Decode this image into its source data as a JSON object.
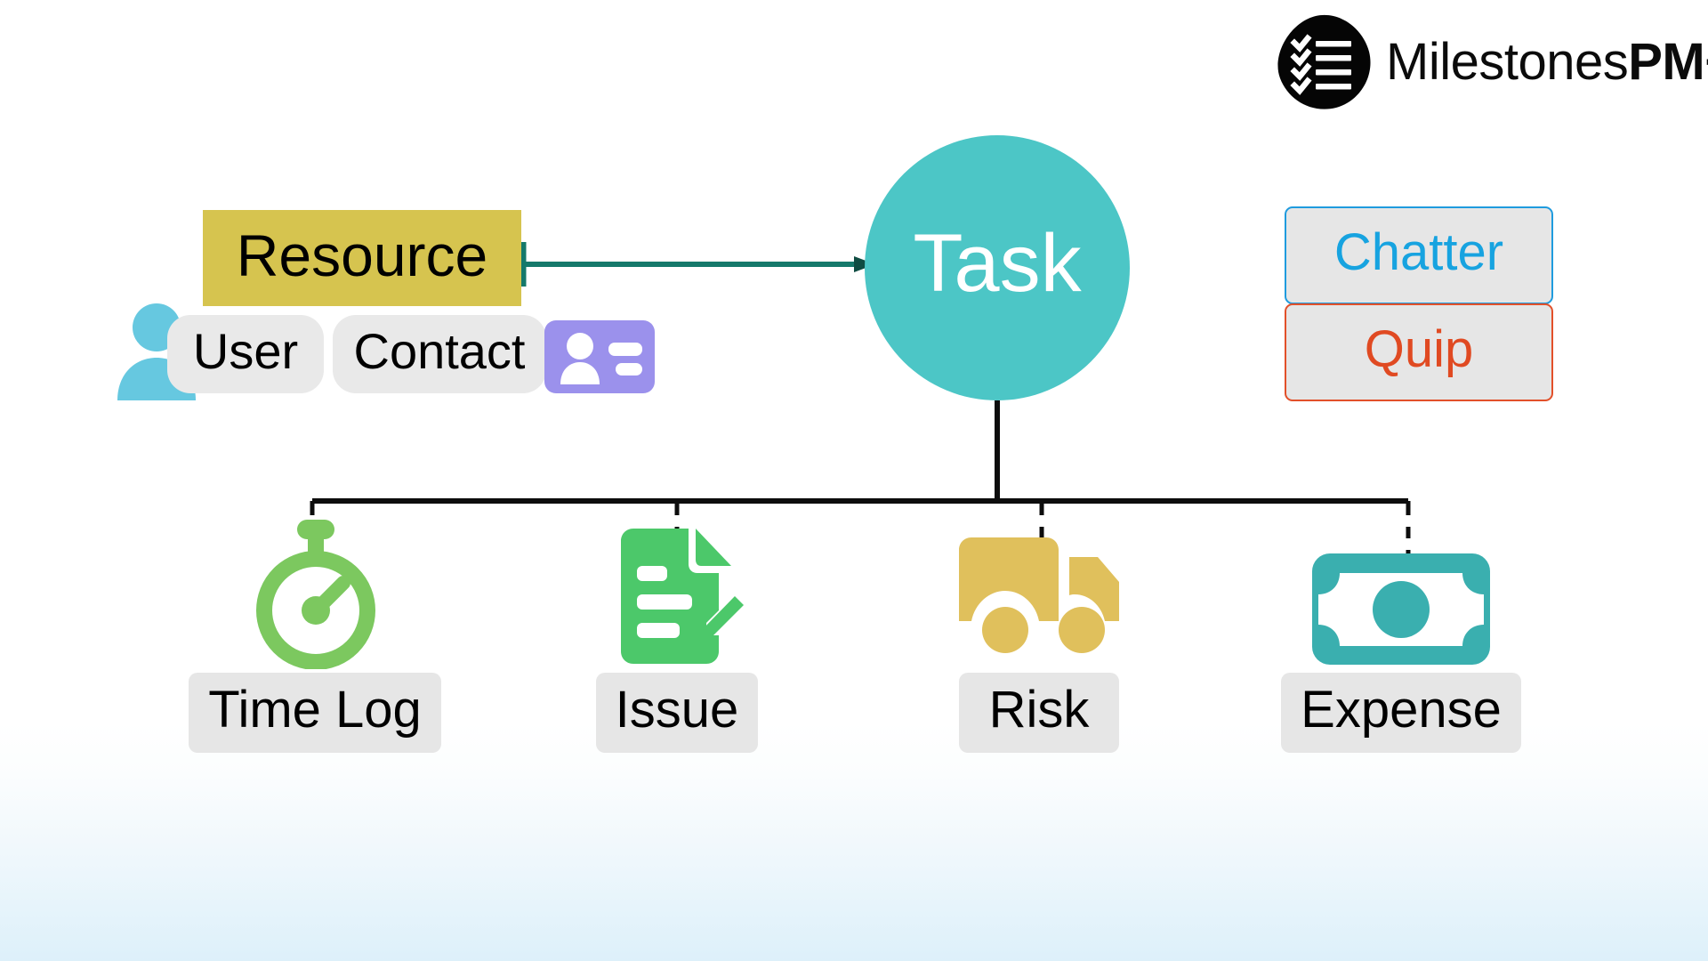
{
  "brand": {
    "logo_icon": "checklist-blob-icon",
    "name_light": "Milestones",
    "name_bold": "PM+"
  },
  "colors": {
    "task_circle": "#4CC6C6",
    "resource_box": "#D6C44F",
    "chip_gray": "#E6E6E6",
    "chatter_accent": "#17A3E0",
    "quip_accent": "#E04A22",
    "connector_teal": "#15796B",
    "connector_black": "#0D0D0D",
    "timelog_icon": "#7CC85F",
    "issue_icon": "#4CC86A",
    "risk_icon": "#E0C05C",
    "expense_icon": "#3AAFAF",
    "person_icon": "#66C8E0",
    "contact_card_icon": "#9B91EC",
    "page_gradient_bottom": "#DDF0FA"
  },
  "diagram": {
    "center_node": {
      "label": "Task",
      "shape": "circle"
    },
    "resource": {
      "label": "Resource",
      "icon": "person-icon",
      "related": [
        {
          "label": "User",
          "icon": "person-icon"
        },
        {
          "label": "Contact",
          "icon": "contact-card-icon"
        }
      ]
    },
    "integrations": [
      {
        "label": "Chatter",
        "accent": "#17A3E0"
      },
      {
        "label": "Quip",
        "accent": "#E04A22"
      }
    ],
    "children": [
      {
        "label": "Time Log",
        "icon": "stopwatch-icon",
        "color": "#7CC85F"
      },
      {
        "label": "Issue",
        "icon": "document-pencil-icon",
        "color": "#4CC86A"
      },
      {
        "label": "Risk",
        "icon": "truck-icon",
        "color": "#E0C05C"
      },
      {
        "label": "Expense",
        "icon": "banknote-icon",
        "color": "#3AAFAF"
      }
    ]
  }
}
